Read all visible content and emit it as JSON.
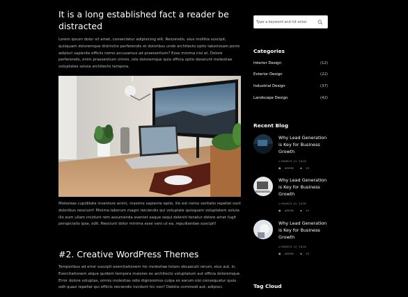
{
  "article": {
    "title": "It is a long established fact a reader be distracted",
    "para1": "Lorem ipsum dolor sit amet, consectetur adipisicing elit. Reiciendis, eius mollitia suscipit, quisquam doloremque distinctio perferendis et doloribus unde architecto optio laboriosam porro adipisci sapiente officiis nemo accusamus ad praesentium? Esse minima nisi et. Dolore perferendis, enim praesentium omnis, iste doloremque quia officia optio deserunt molestiae voluptates soluta architecto tempora.",
    "para2": "Molestiae cupiditate inventore animi, maxime sapiente optio, illo est nemo veritatis repellat sunt doloribus nesciunt! Minima laborum magni reiciendis qui voluptate quisquam voluptatem soluta illo eum ullam incidunt rem assumenda eveniet eaque sequi deleniti tenetur dolore amet fugit perspiciatis ipsa, odit. Nesciunt dolor minima esse vero ut ea, repudiandae suscipit!",
    "heading2": "#2. Creative WordPress Themes",
    "para3": "Temporibus ad error suscipit exercitationem hic molestiae totam obcaecati rerum, eius aut, in. Exercitationem atque quidem tempora maiores ex architecto voluptatum aut officia doloremque. Error dolore voluptas, omnis molestias odio dignissimos culpa ex earum nisi consequatur quos odit quasi repellat qui officiis reiciendis incidunt hic non? Debitis commodi aut, adipisci."
  },
  "sidebar": {
    "search_placeholder": "Type a keyword and hit enter",
    "categories_title": "Categories",
    "categories": [
      {
        "label": "Interior Design",
        "count": "(12)"
      },
      {
        "label": "Exterior Design",
        "count": "(22)"
      },
      {
        "label": "Industrial Design",
        "count": "(37)"
      },
      {
        "label": "Landscape Design",
        "count": "(42)"
      }
    ],
    "recent_title": "Recent Blog",
    "posts": [
      {
        "title": "Why Lead Generation is Key for Business Growth",
        "date": "MARCH 12, 2018",
        "author": "ADMIN",
        "comments": "19"
      },
      {
        "title": "Why Lead Generation is Key for Business Growth",
        "date": "MARCH 12, 2018",
        "author": "ADMIN",
        "comments": "19"
      },
      {
        "title": "Why Lead Generation is Key for Business Growth",
        "date": "MARCH 12, 2018",
        "author": "ADMIN",
        "comments": "19"
      }
    ],
    "tag_title": "Tag Cloud"
  },
  "colors": {
    "background": "#000000",
    "text": "#ffffff",
    "muted": "#bdbdbd",
    "meta": "#9a9a9a"
  }
}
